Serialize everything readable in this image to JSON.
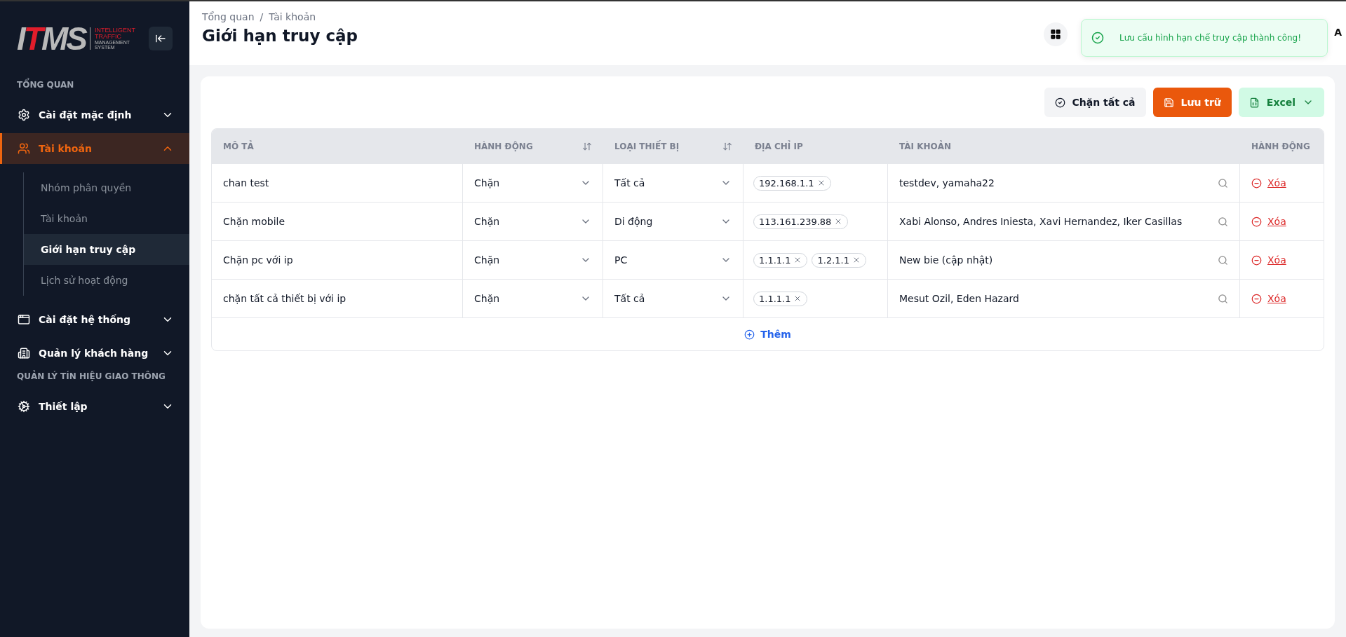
{
  "sidebar": {
    "logo": {
      "mark": "ITMS",
      "line_1": "INTELLIGENT",
      "line_2": "TRAFFIC",
      "line_3": "MANAGEMENT",
      "line_4": "SYSTEM"
    },
    "sections": [
      {
        "kind": "heading",
        "label": "TỔNG QUAN"
      },
      {
        "kind": "item",
        "label": "Cài đặt mặc định",
        "selected": false,
        "expanded": false
      },
      {
        "kind": "item",
        "label": "Tài khoản",
        "selected": true,
        "expanded": true,
        "children": [
          {
            "label": "Nhóm phân quyền",
            "selected": false
          },
          {
            "label": "Tài khoản",
            "selected": false
          },
          {
            "label": "Giới hạn truy cập",
            "selected": true
          },
          {
            "label": "Lịch sử hoạt động",
            "selected": false
          }
        ]
      },
      {
        "kind": "item",
        "label": "Cài đặt hệ thống",
        "selected": false,
        "expanded": false
      },
      {
        "kind": "item",
        "label": "Quản lý khách hàng",
        "selected": false,
        "expanded": false
      },
      {
        "kind": "heading",
        "label": "QUẢN LÝ TÍN HIỆU GIAO THÔNG"
      },
      {
        "kind": "item",
        "label": "Thiết lập",
        "selected": false,
        "expanded": false
      }
    ]
  },
  "header": {
    "breadcrumb": [
      "Tổng quan",
      "Tài khoản"
    ],
    "separator": "/",
    "title": "Giới hạn truy cập",
    "user_initial": "A"
  },
  "toast": {
    "message": "Lưu cấu hình hạn chế truy cập thành công!"
  },
  "toolbar": {
    "block_all": "Chặn tất cả",
    "save": "Lưu trữ",
    "excel": "Excel"
  },
  "table": {
    "columns": [
      {
        "label": "MÔ TẢ",
        "sortable": false
      },
      {
        "label": "HÀNH ĐỘNG",
        "sortable": true
      },
      {
        "label": "LOẠI THIẾT BỊ",
        "sortable": true
      },
      {
        "label": "ĐỊA CHỈ IP",
        "sortable": false
      },
      {
        "label": "TÀI KHOẢN",
        "sortable": false
      },
      {
        "label": "HÀNH ĐỘNG",
        "sortable": false
      }
    ],
    "rows": [
      {
        "description": "chan test",
        "action": "Chặn",
        "device": "Tất cả",
        "ips": [
          "192.168.1.1"
        ],
        "accounts": "testdev, yamaha22",
        "delete": "Xóa"
      },
      {
        "description": "Chặn mobile",
        "action": "Chặn",
        "device": "Di động",
        "ips": [
          "113.161.239.88"
        ],
        "accounts": "Xabi Alonso, Andres Iniesta, Xavi Hernandez, Iker Casillas",
        "delete": "Xóa"
      },
      {
        "description": "Chặn pc với ip",
        "action": "Chặn",
        "device": "PC",
        "ips": [
          "1.1.1.1",
          "1.2.1.1"
        ],
        "accounts": "New bie (cập nhật)",
        "delete": "Xóa"
      },
      {
        "description": "chặn tất cả thiết bị với ip",
        "action": "Chặn",
        "device": "Tất cả",
        "ips": [
          "1.1.1.1"
        ],
        "accounts": "Mesut Ozil, Eden Hazard",
        "delete": "Xóa"
      }
    ],
    "add": "Thêm"
  }
}
